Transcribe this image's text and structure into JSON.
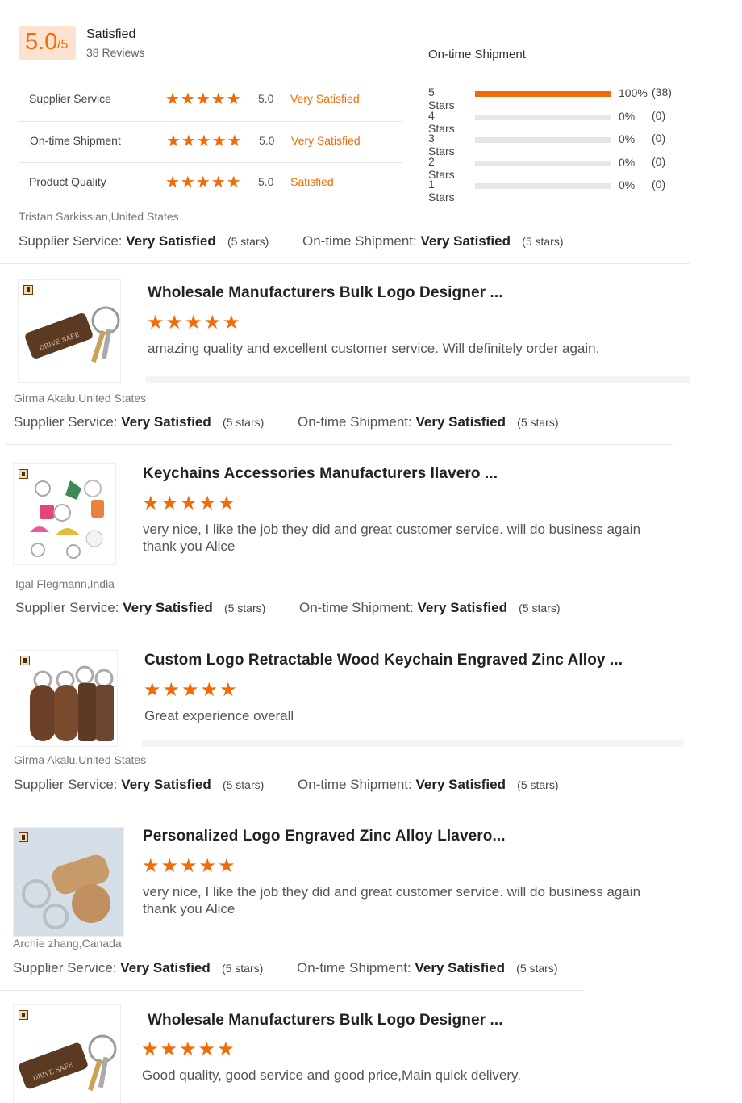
{
  "summary": {
    "score": "5.0",
    "denominator": "/5",
    "label": "Satisfied",
    "reviews": "38 Reviews"
  },
  "ratings": [
    {
      "label": "Supplier Service",
      "stars": "★★★★★",
      "score": "5.0",
      "text": "Very Satisfied"
    },
    {
      "label": "On-time Shipment",
      "stars": "★★★★★",
      "score": "5.0",
      "text": "Very Satisfied"
    },
    {
      "label": "Product Quality",
      "stars": "★★★★★",
      "score": "5.0",
      "text": "Satisfied"
    }
  ],
  "shipment": {
    "title": "On-time Shipment",
    "rows": [
      {
        "label": "5  Stars",
        "fraction": 1.0,
        "pct": "100%",
        "count": "(38)"
      },
      {
        "label": "4  Stars",
        "fraction": 0,
        "pct": "0%",
        "count": "(0)"
      },
      {
        "label": "3  Stars",
        "fraction": 0,
        "pct": "0%",
        "count": "(0)"
      },
      {
        "label": "2  Stars",
        "fraction": 0,
        "pct": "0%",
        "count": "(0)"
      },
      {
        "label": "1  Stars",
        "fraction": 0,
        "pct": "0%",
        "count": "(0)"
      }
    ]
  },
  "labels": {
    "supplier_service": "Supplier Service:",
    "ontime_shipment": "On-time Shipment:",
    "very_satisfied": "Very Satisfied",
    "five_stars": "(5 stars)"
  },
  "reviews": [
    {
      "reviewer": "Tristan Sarkissian,United States"
    },
    {
      "title": "Wholesale Manufacturers Bulk Logo Designer ...",
      "stars": "★★★★★",
      "comment": "amazing quality and excellent customer service. Will definitely order again.",
      "reviewer": "Girma Akalu,United States"
    },
    {
      "title": "Keychains Accessories Manufacturers llavero ...",
      "stars": "★★★★★",
      "comment": "very nice, I like the job they did and great customer service. will do business again thank you Alice",
      "reviewer": "Igal Flegmann,India"
    },
    {
      "title": "Custom Logo Retractable  Wood Keychain  Engraved Zinc Alloy ...",
      "stars": "★★★★★",
      "comment": "Great experience overall",
      "reviewer": "Girma Akalu,United States"
    },
    {
      "title": "Personalized Logo Engraved Zinc Alloy Llavero...",
      "stars": "★★★★★",
      "comment": "very nice, I like the job they did and great customer service. will do business again thank you Alice",
      "reviewer": "Archie zhang,Canada"
    },
    {
      "title": "Wholesale Manufacturers Bulk Logo Designer ...",
      "stars": "★★★★★",
      "comment": "Good quality, good service and good price,Main quick delivery."
    }
  ],
  "colors": {
    "accent": "#f26b06",
    "score_bg": "#fde3cf",
    "track": "#e6e6e6"
  }
}
